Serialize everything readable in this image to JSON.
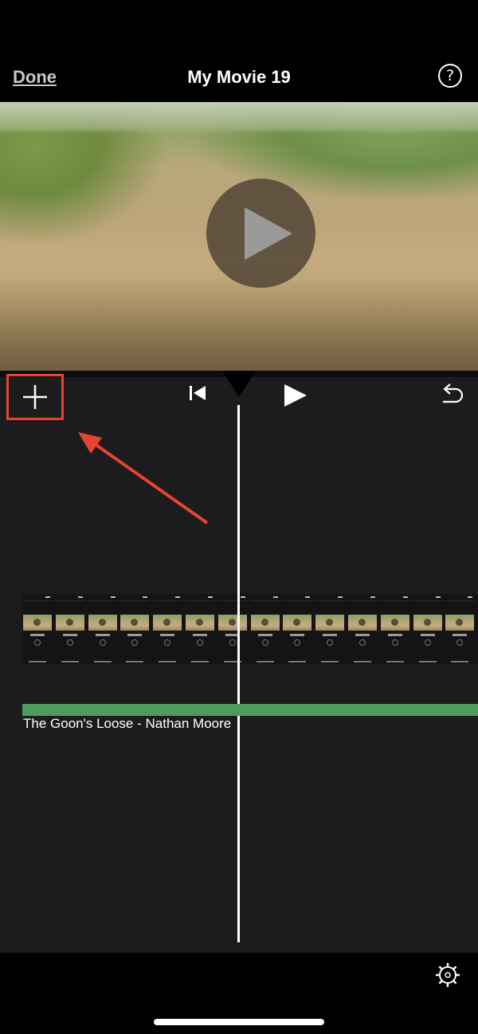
{
  "header": {
    "done_label": "Done",
    "title": "My Movie 19",
    "help_label": "?"
  },
  "preview": {
    "play_icon": "play-icon"
  },
  "toolbar": {
    "add_icon": "plus-icon",
    "skip_icon": "skip-to-start-icon",
    "play_icon": "play-icon",
    "undo_icon": "undo-icon"
  },
  "timeline": {
    "clip_count": 14,
    "audio_track_label": "The Goon's Loose - Nathan Moore"
  },
  "footer": {
    "settings_icon": "gear-icon"
  },
  "colors": {
    "highlight": "#e5452e",
    "audio_track": "#4e9a5f",
    "editor_bg": "#1c1c1e"
  }
}
